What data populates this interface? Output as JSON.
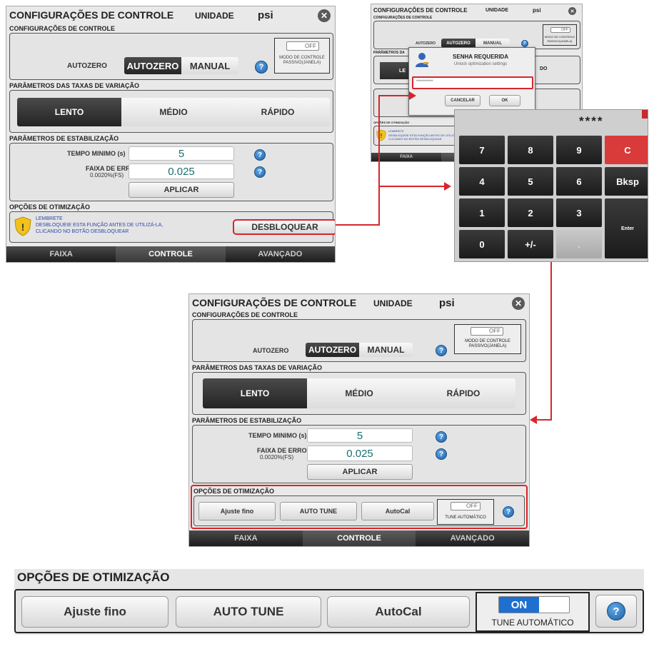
{
  "screen": {
    "title": "CONFIGURAÇÕES DE CONTROLE",
    "unit_label": "UNIDADE",
    "unit_value": "psi",
    "section_control": "CONFIGURAÇÕES DE CONTROLE",
    "autozero_label": "AUTOZERO",
    "autozero_option": "AUTOZERO",
    "manual_option": "MANUAL",
    "toggle_off": "OFF",
    "passive_mode_line1": "MODO DE CONTROLE",
    "passive_mode_line2": "PASSIVO(JANELA)",
    "section_rates": "PARÂMETROS DAS TAXAS DE VARIAÇÃO",
    "rate_slow": "LENTO",
    "rate_medium": "MÉDIO",
    "rate_fast": "RÁPIDO",
    "section_stab": "PARÂMETROS DE ESTABILIZAÇÃO",
    "min_time_label": "TEMPO MINIMO (s)",
    "min_time_value": "5",
    "error_band_label": "FAIXA DE ERRO",
    "error_band_sub": "0.0020%(FS)",
    "error_band_value": "0.025",
    "apply": "APLICAR",
    "section_opt": "OPÇÕES DE OTIMIZAÇÃO",
    "reminder_title": "LEMBRETE",
    "reminder_line1": "DESBLOQUEIE ESTA FUNÇÃO ANTES DE UTILIZÁ-LA,",
    "reminder_line2": "CLICANDO NO BOTÃO DESBLOQUEAR",
    "unlock": "DESBLOQUEAR",
    "tab_range": "FAIXA",
    "tab_control": "CONTROLE",
    "tab_advanced": "AVANÇADO",
    "fine_adjust": "Ajuste fino",
    "auto_tune": "AUTO TUNE",
    "autocal": "AutoCal",
    "auto_tune_toggle_label": "TUNE AUTOMÁTICO",
    "toggle_on": "ON"
  },
  "password_dialog": {
    "title": "SENHA REQUERIDA",
    "message": "Unlock optimization settings",
    "masked": "**********",
    "cancel": "CANCELAR",
    "ok": "OK",
    "partial_dark_btn": "LE",
    "partial_right_text": "DO",
    "partial_section": "PARÂMETROS DA"
  },
  "keypad": {
    "display": "****",
    "keys": [
      "7",
      "8",
      "9",
      "C",
      "4",
      "5",
      "6",
      "Bksp",
      "1",
      "2",
      "3",
      "Enter",
      "0",
      "+/-",
      ".",
      ""
    ]
  },
  "colors": {
    "accent_red": "#d7262b",
    "value_teal": "#1a6f73",
    "toggle_on_blue": "#1e6fd0",
    "clear_red": "#d93a3a"
  }
}
